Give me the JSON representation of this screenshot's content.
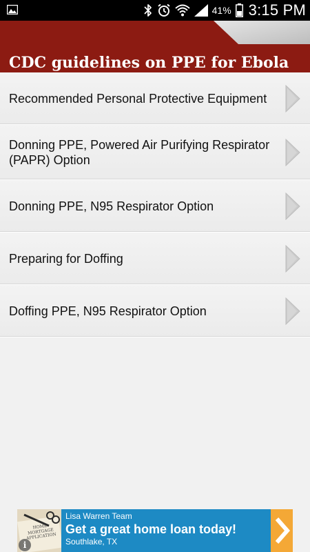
{
  "status_bar": {
    "battery_percent": "41%",
    "time": "3:15 PM",
    "icons": [
      "image-notification-icon",
      "bluetooth-icon",
      "alarm-icon",
      "wifi-icon",
      "cell-signal-icon",
      "battery-icon"
    ]
  },
  "header": {
    "title": "CDC guidelines on PPE for Ebola",
    "background_color": "#8c1b12"
  },
  "menu": {
    "items": [
      {
        "label": "Recommended Personal Protective Equipment"
      },
      {
        "label": "Donning PPE, Powered Air Purifying Respirator (PAPR) Option"
      },
      {
        "label": "Donning PPE, N95 Respirator Option"
      },
      {
        "label": "Preparing for Doffing"
      },
      {
        "label": "Doffing PPE, N95 Respirator Option"
      }
    ]
  },
  "ad": {
    "advertiser": "Lisa Warren Team",
    "headline": "Get a great home loan today!",
    "location": "Southlake, TX",
    "thumbnail_text": "HOME MORTGAGE APPLICATION",
    "info_icon": "i",
    "background_color": "#1d8ac4",
    "arrow_color": "#f4a836"
  }
}
